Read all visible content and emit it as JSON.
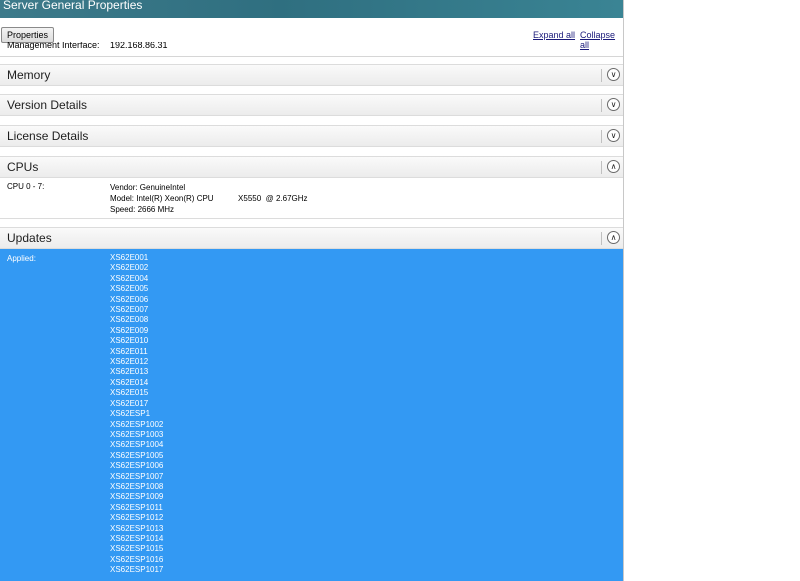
{
  "window": {
    "title": "Server General Properties"
  },
  "toolbar": {
    "properties_label": "Properties",
    "expand_all": "Expand all",
    "collapse_all": "Collapse all"
  },
  "general": {
    "mgmt_label": "Management Interface:",
    "mgmt_value": "192.168.86.31"
  },
  "sections": {
    "memory": {
      "title": "Memory",
      "icon": "chevron-down-icon"
    },
    "version": {
      "title": "Version Details",
      "icon": "chevron-down-icon"
    },
    "license": {
      "title": "License Details",
      "icon": "chevron-down-icon"
    },
    "cpus": {
      "title": "CPUs",
      "icon": "chevron-up-icon"
    },
    "updates": {
      "title": "Updates",
      "icon": "chevron-up-icon"
    }
  },
  "cpus": {
    "label": "CPU 0 - 7:",
    "vendor": "Vendor: GenuineIntel",
    "model": "Model: Intel(R) Xeon(R) CPU           X5550  @ 2.67GHz",
    "speed": "Speed: 2666 MHz"
  },
  "updates": {
    "applied_label": "Applied:",
    "items": [
      "XS62E001",
      "XS62E002",
      "XS62E004",
      "XS62E005",
      "XS62E006",
      "XS62E007",
      "XS62E008",
      "XS62E009",
      "XS62E010",
      "XS62E011",
      "XS62E012",
      "XS62E013",
      "XS62E014",
      "XS62E015",
      "XS62E017",
      "XS62ESP1",
      "XS62ESP1002",
      "XS62ESP1003",
      "XS62ESP1004",
      "XS62ESP1005",
      "XS62ESP1006",
      "XS62ESP1007",
      "XS62ESP1008",
      "XS62ESP1009",
      "XS62ESP1011",
      "XS62ESP1012",
      "XS62ESP1013",
      "XS62ESP1014",
      "XS62ESP1015",
      "XS62ESP1016",
      "XS62ESP1017"
    ]
  },
  "colors": {
    "titlebar": "#2f6f80",
    "selection": "#3399f3"
  }
}
